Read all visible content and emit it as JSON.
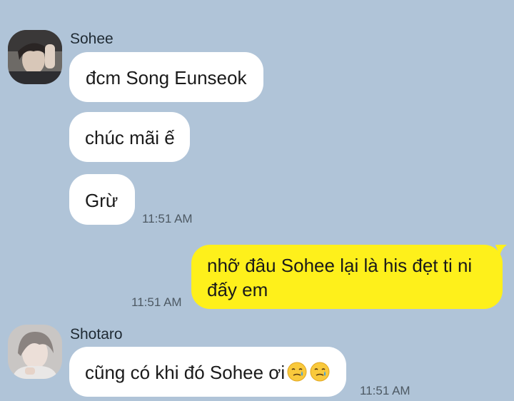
{
  "colors": {
    "background": "#b0c4d8",
    "incoming_bubble": "#ffffff",
    "outgoing_bubble": "#fef01b"
  },
  "messages": [
    {
      "sender": "Sohee",
      "avatar": "avatar-sohee",
      "bubbles": [
        "đcm Song Eunseok",
        "chúc mãi ế",
        "Grừ"
      ],
      "time": "11:51 AM"
    },
    {
      "outgoing": true,
      "text": "nhỡ đâu Sohee lại là his đẹt ti ni đấy em",
      "time": "11:51 AM"
    },
    {
      "sender": "Shotaro",
      "avatar": "avatar-shotaro",
      "text": "cũng có khi đó Sohee ơi",
      "emojis": [
        "smiling-face-with-tear-icon",
        "smiling-face-with-tear-icon"
      ],
      "time": "11:51 AM"
    }
  ]
}
